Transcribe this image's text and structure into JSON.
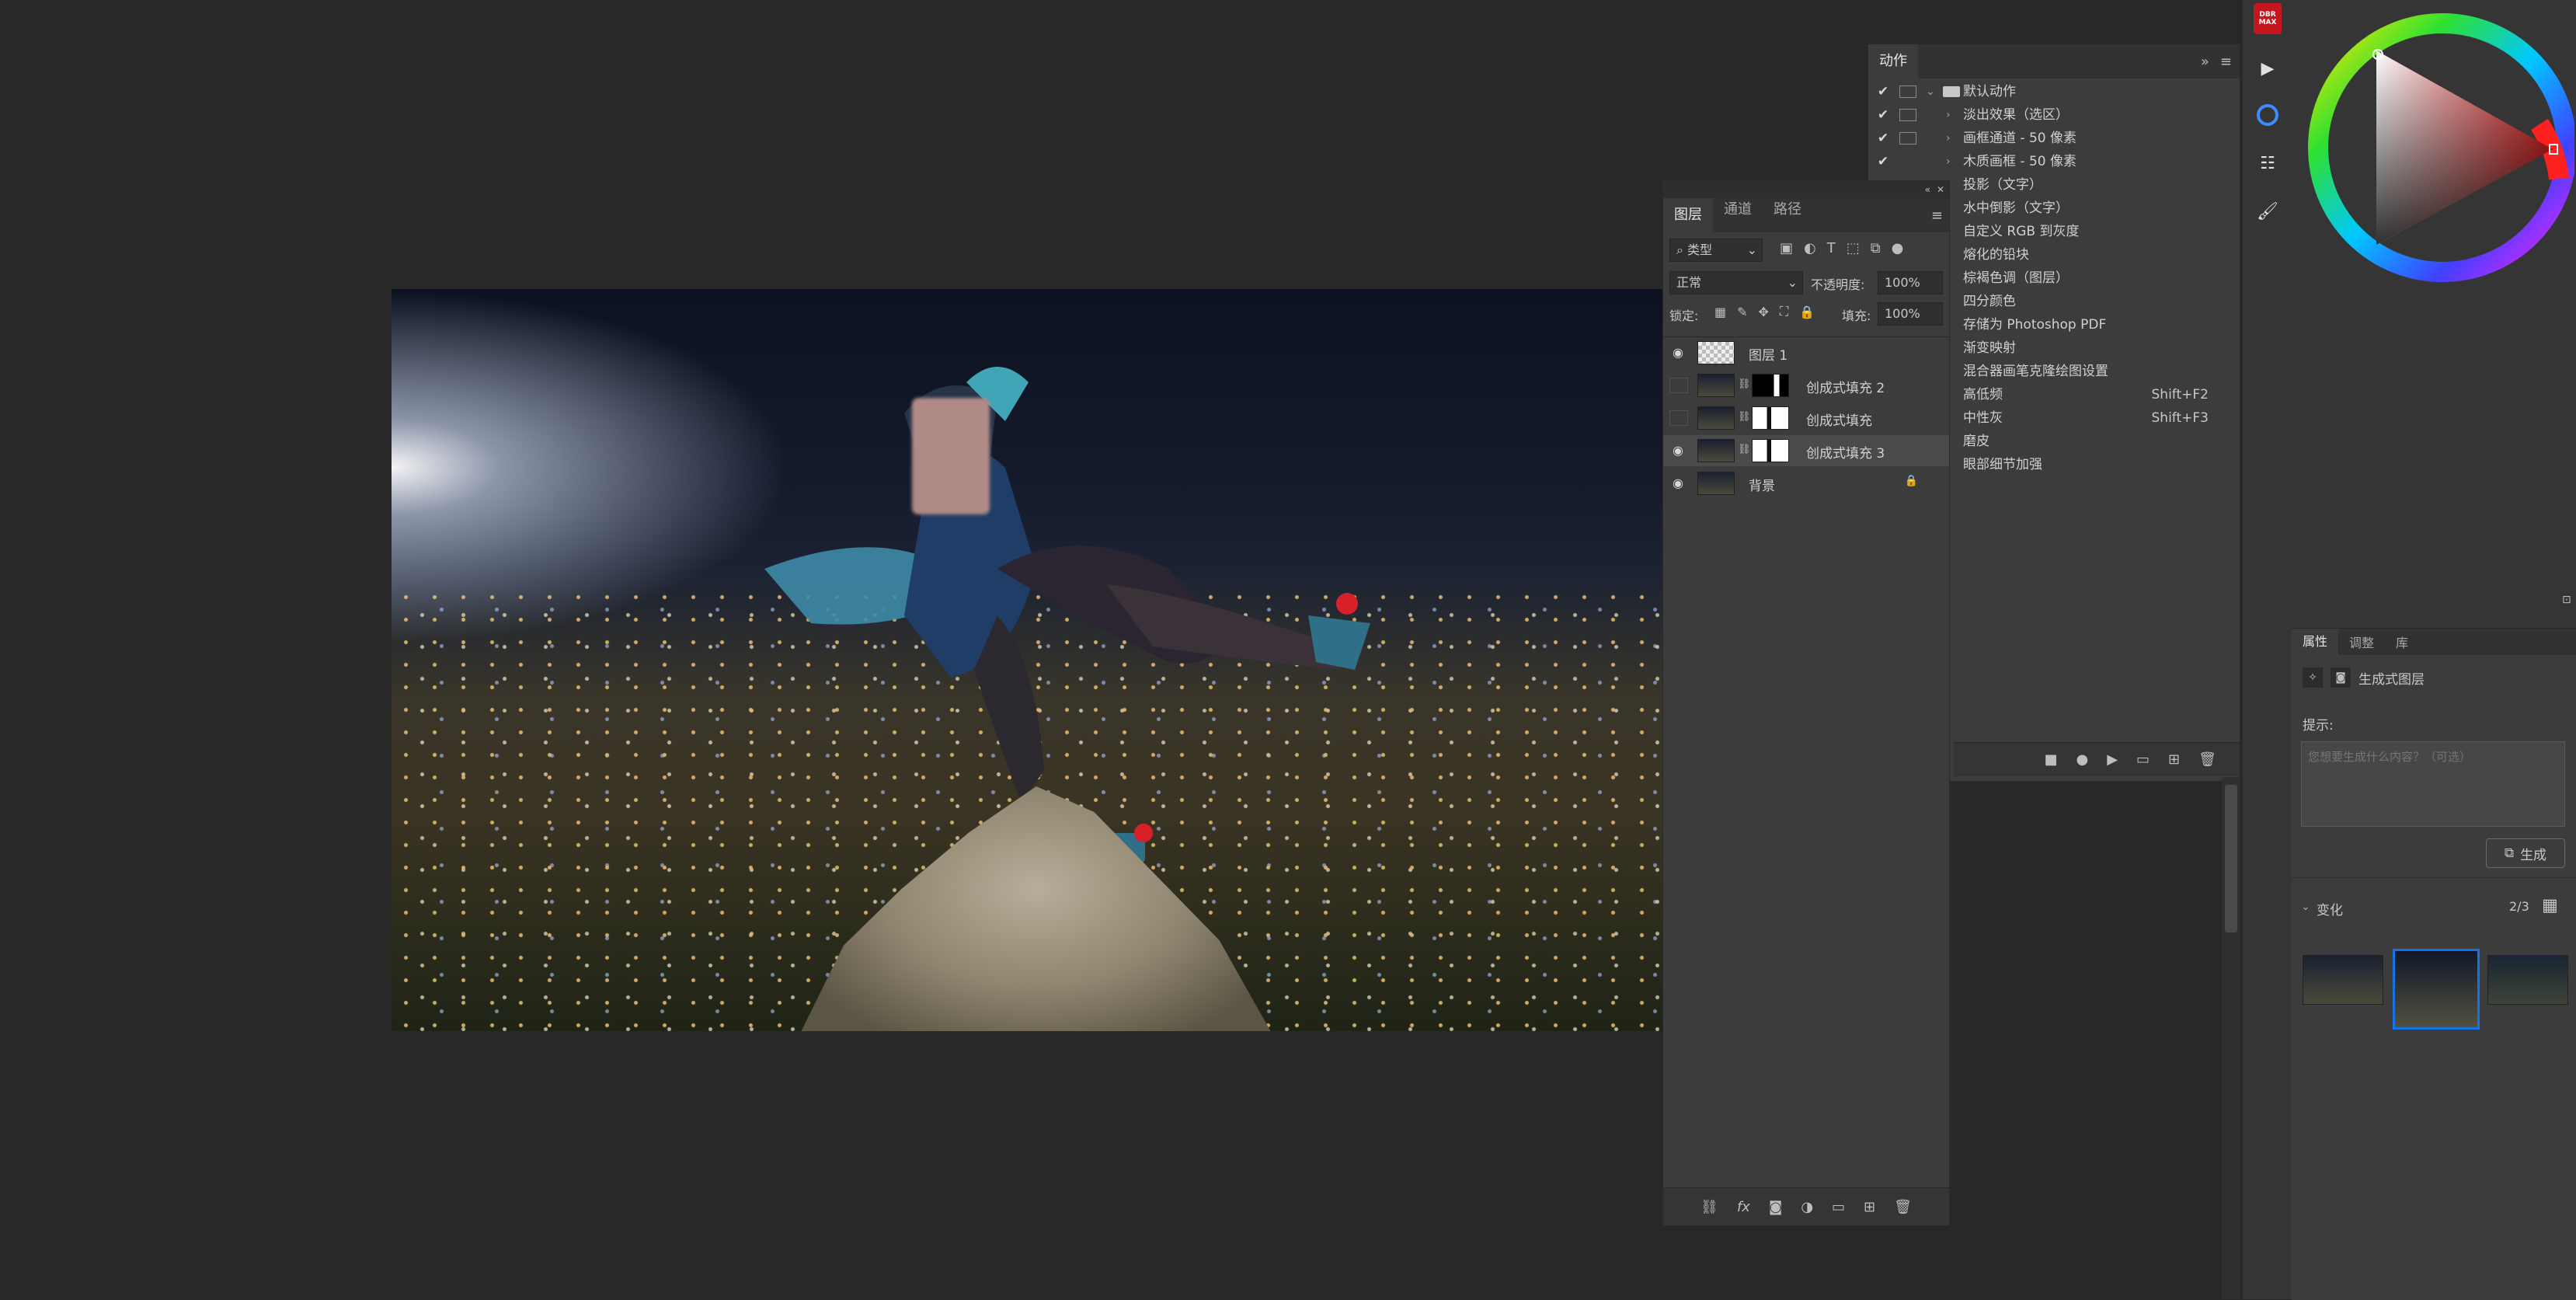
{
  "actions_panel": {
    "tab": "动作",
    "rows": [
      {
        "check": "✔",
        "dialog": true,
        "arrow": "⌄",
        "folder": true,
        "label": "默认动作",
        "key": ""
      },
      {
        "check": "✔",
        "dialog": true,
        "arrow": "›",
        "label": "淡出效果（选区）",
        "key": ""
      },
      {
        "check": "✔",
        "dialog": true,
        "arrow": "›",
        "label": "画框通道 - 50 像素",
        "key": ""
      },
      {
        "check": "✔",
        "dialog": false,
        "arrow": "›",
        "label": "木质画框 - 50 像素",
        "key": ""
      },
      {
        "check": "",
        "dialog": false,
        "arrow": "",
        "label": "投影（文字）",
        "key": ""
      },
      {
        "check": "",
        "dialog": false,
        "arrow": "",
        "label": "水中倒影（文字）",
        "key": ""
      },
      {
        "check": "",
        "dialog": false,
        "arrow": "",
        "label": "自定义 RGB 到灰度",
        "key": ""
      },
      {
        "check": "",
        "dialog": false,
        "arrow": "",
        "label": "熔化的铅块",
        "key": ""
      },
      {
        "check": "",
        "dialog": false,
        "arrow": "",
        "label": "棕褐色调（图层）",
        "key": ""
      },
      {
        "check": "",
        "dialog": false,
        "arrow": "",
        "label": "四分颜色",
        "key": ""
      },
      {
        "check": "",
        "dialog": false,
        "arrow": "",
        "label": "存储为 Photoshop PDF",
        "key": ""
      },
      {
        "check": "",
        "dialog": false,
        "arrow": "",
        "label": "渐变映射",
        "key": ""
      },
      {
        "check": "",
        "dialog": false,
        "arrow": "",
        "label": "混合器画笔克隆绘图设置",
        "key": ""
      },
      {
        "check": "",
        "dialog": false,
        "arrow": "",
        "label": "高低频",
        "key": "Shift+F2"
      },
      {
        "check": "",
        "dialog": false,
        "arrow": "",
        "label": "中性灰",
        "key": "Shift+F3"
      },
      {
        "check": "",
        "dialog": false,
        "arrow": "",
        "label": "磨皮",
        "key": ""
      },
      {
        "check": "",
        "dialog": false,
        "arrow": "",
        "label": "眼部细节加强",
        "key": ""
      }
    ]
  },
  "layers_panel": {
    "tabs": [
      "图层",
      "通道",
      "路径"
    ],
    "kind_filter": "类型",
    "blend_mode": "正常",
    "opacity_label": "不透明度:",
    "opacity_value": "100%",
    "lock_label": "锁定:",
    "fill_label": "填充:",
    "fill_value": "100%",
    "layers": [
      {
        "name": "图层 1",
        "visible": true,
        "mask": false,
        "selected": false,
        "locked": false
      },
      {
        "name": "创成式填充 2",
        "visible": false,
        "mask": true,
        "mask_style": "dark",
        "selected": false,
        "locked": false
      },
      {
        "name": "创成式填充",
        "visible": false,
        "mask": true,
        "mask_style": "light",
        "selected": false,
        "locked": false
      },
      {
        "name": "创成式填充 3",
        "visible": true,
        "mask": true,
        "mask_style": "light",
        "selected": true,
        "locked": false
      },
      {
        "name": "背景",
        "visible": true,
        "mask": false,
        "selected": false,
        "locked": true
      }
    ],
    "footer_icons": [
      "link-icon",
      "fx-icon",
      "add-mask-icon",
      "adjustment-icon",
      "group-icon",
      "new-layer-icon",
      "delete-icon"
    ]
  },
  "properties_panel": {
    "tabs": [
      "属性",
      "调整",
      "库"
    ],
    "layer_type": "生成式图层",
    "prompt_label": "提示:",
    "prompt_placeholder": "您想要生成什么内容？（可选）",
    "generate_label": "生成",
    "variations_label": "变化",
    "variations_count": "2/3"
  },
  "brand_badge": "DBR MAX",
  "colors": {
    "background": "#282828",
    "panel": "#3c3c3c",
    "selection": "#1473e6"
  }
}
